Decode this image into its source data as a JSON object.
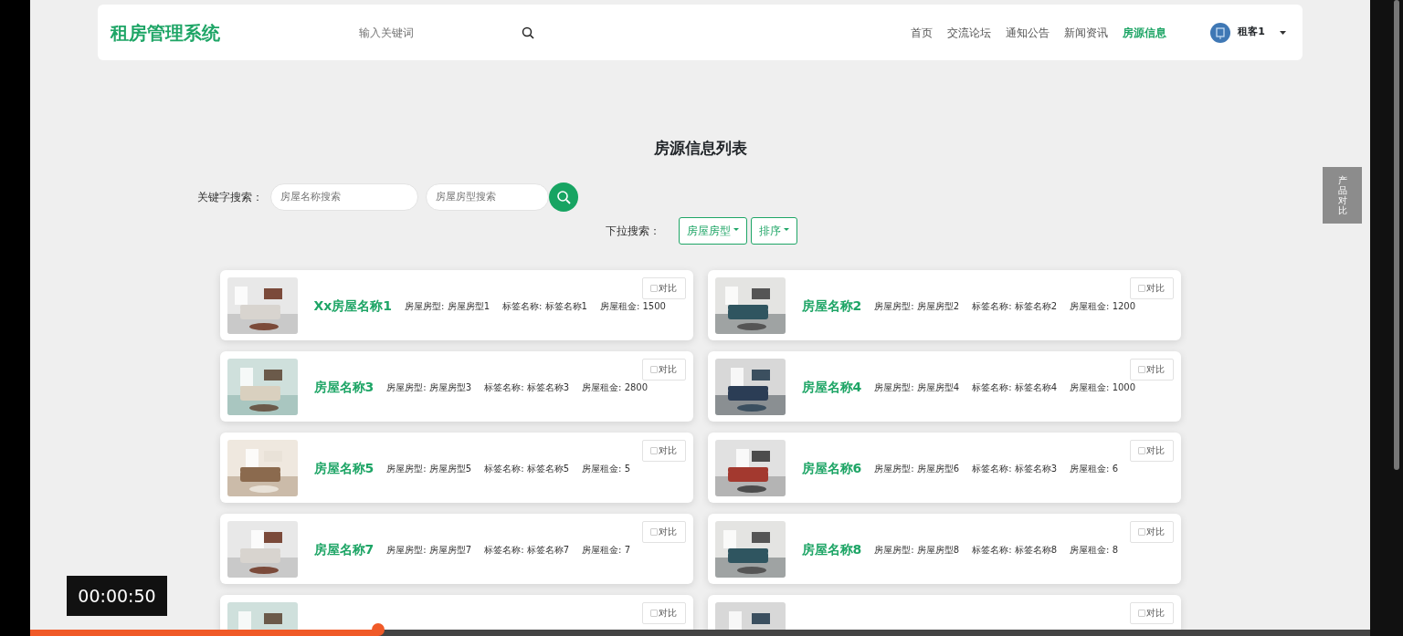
{
  "header": {
    "logo": "租房管理系统",
    "search": {
      "placeholder": "输入关键词"
    },
    "nav": [
      {
        "label": "首页",
        "selected": false
      },
      {
        "label": "交流论坛",
        "selected": false
      },
      {
        "label": "通知公告",
        "selected": false
      },
      {
        "label": "新闻资讯",
        "selected": false
      },
      {
        "label": "房源信息",
        "selected": true
      }
    ],
    "user": {
      "name": "租客1"
    }
  },
  "page_title": "房源信息列表",
  "filters": {
    "keyword_label": "关键字搜索：",
    "name_field": {
      "placeholder": "房屋名称搜索"
    },
    "type_field": {
      "placeholder": "房屋房型搜索"
    },
    "dropdown_label": "下拉搜索：",
    "dropdowns": [
      "房屋房型",
      "排序"
    ]
  },
  "side_tab": "产品对比",
  "houses": [
    {
      "name": "Xx房屋名称1",
      "type_label": "房屋房型:",
      "type": "房屋房型1",
      "tag_label": "标签名称:",
      "tag": "标签名称1",
      "rent_label": "房屋租金:",
      "rent": "1500",
      "compare": "对比",
      "checked": false
    },
    {
      "name": "房屋名称2",
      "type_label": "房屋房型:",
      "type": "房屋房型2",
      "tag_label": "标签名称:",
      "tag": "标签名称2",
      "rent_label": "房屋租金:",
      "rent": "1200",
      "compare": "对比",
      "checked": false
    },
    {
      "name": "房屋名称3",
      "type_label": "房屋房型:",
      "type": "房屋房型3",
      "tag_label": "标签名称:",
      "tag": "标签名称3",
      "rent_label": "房屋租金:",
      "rent": "2800",
      "compare": "对比",
      "checked": false
    },
    {
      "name": "房屋名称4",
      "type_label": "房屋房型:",
      "type": "房屋房型4",
      "tag_label": "标签名称:",
      "tag": "标签名称4",
      "rent_label": "房屋租金:",
      "rent": "1000",
      "compare": "对比",
      "checked": false
    },
    {
      "name": "房屋名称5",
      "type_label": "房屋房型:",
      "type": "房屋房型5",
      "tag_label": "标签名称:",
      "tag": "标签名称5",
      "rent_label": "房屋租金:",
      "rent": "5",
      "compare": "对比",
      "checked": false
    },
    {
      "name": "房屋名称6",
      "type_label": "房屋房型:",
      "type": "房屋房型6",
      "tag_label": "标签名称:",
      "tag": "标签名称3",
      "rent_label": "房屋租金:",
      "rent": "6",
      "compare": "对比",
      "checked": false
    },
    {
      "name": "房屋名称7",
      "type_label": "房屋房型:",
      "type": "房屋房型7",
      "tag_label": "标签名称:",
      "tag": "标签名称7",
      "rent_label": "房屋租金:",
      "rent": "7",
      "compare": "对比",
      "checked": false
    },
    {
      "name": "房屋名称8",
      "type_label": "房屋房型:",
      "type": "房屋房型8",
      "tag_label": "标签名称:",
      "tag": "标签名称8",
      "rent_label": "房屋租金:",
      "rent": "8",
      "compare": "对比",
      "checked": false
    },
    {
      "compare": "对比",
      "checked": false
    },
    {
      "compare": "对比",
      "checked": false
    }
  ],
  "video_player": {
    "time": "00:00:50",
    "level": 0.26
  }
}
